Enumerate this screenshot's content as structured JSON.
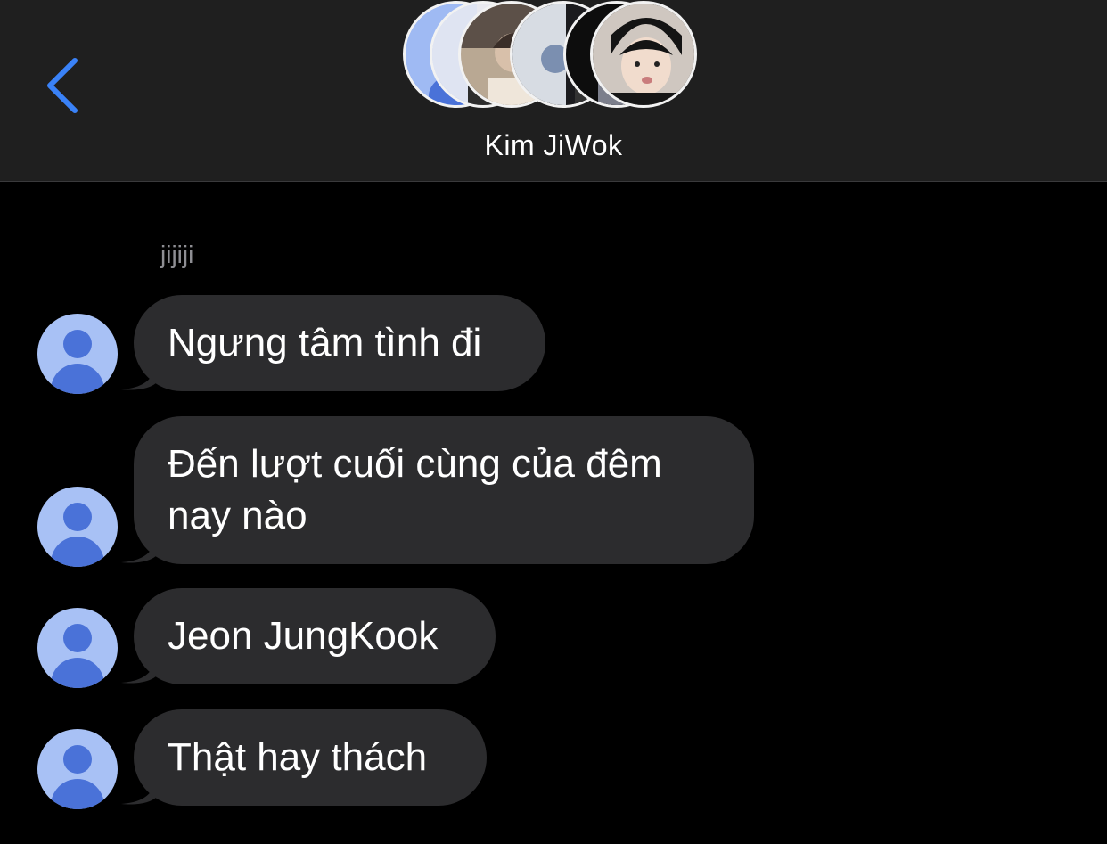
{
  "header": {
    "back_icon": "chevron-left-icon",
    "title": "Kim JiWok",
    "accent_color": "#3a82f7",
    "avatar_count": 6
  },
  "conversation": {
    "sender_name": "jijiji",
    "bubble_color": "#2c2c2e",
    "messages": [
      {
        "text": "Ngưng tâm tình đi"
      },
      {
        "text": "Đến lượt cuối cùng của đêm nay nào"
      },
      {
        "text": "Jeon JungKook"
      },
      {
        "text": "Thật hay thách"
      }
    ]
  }
}
